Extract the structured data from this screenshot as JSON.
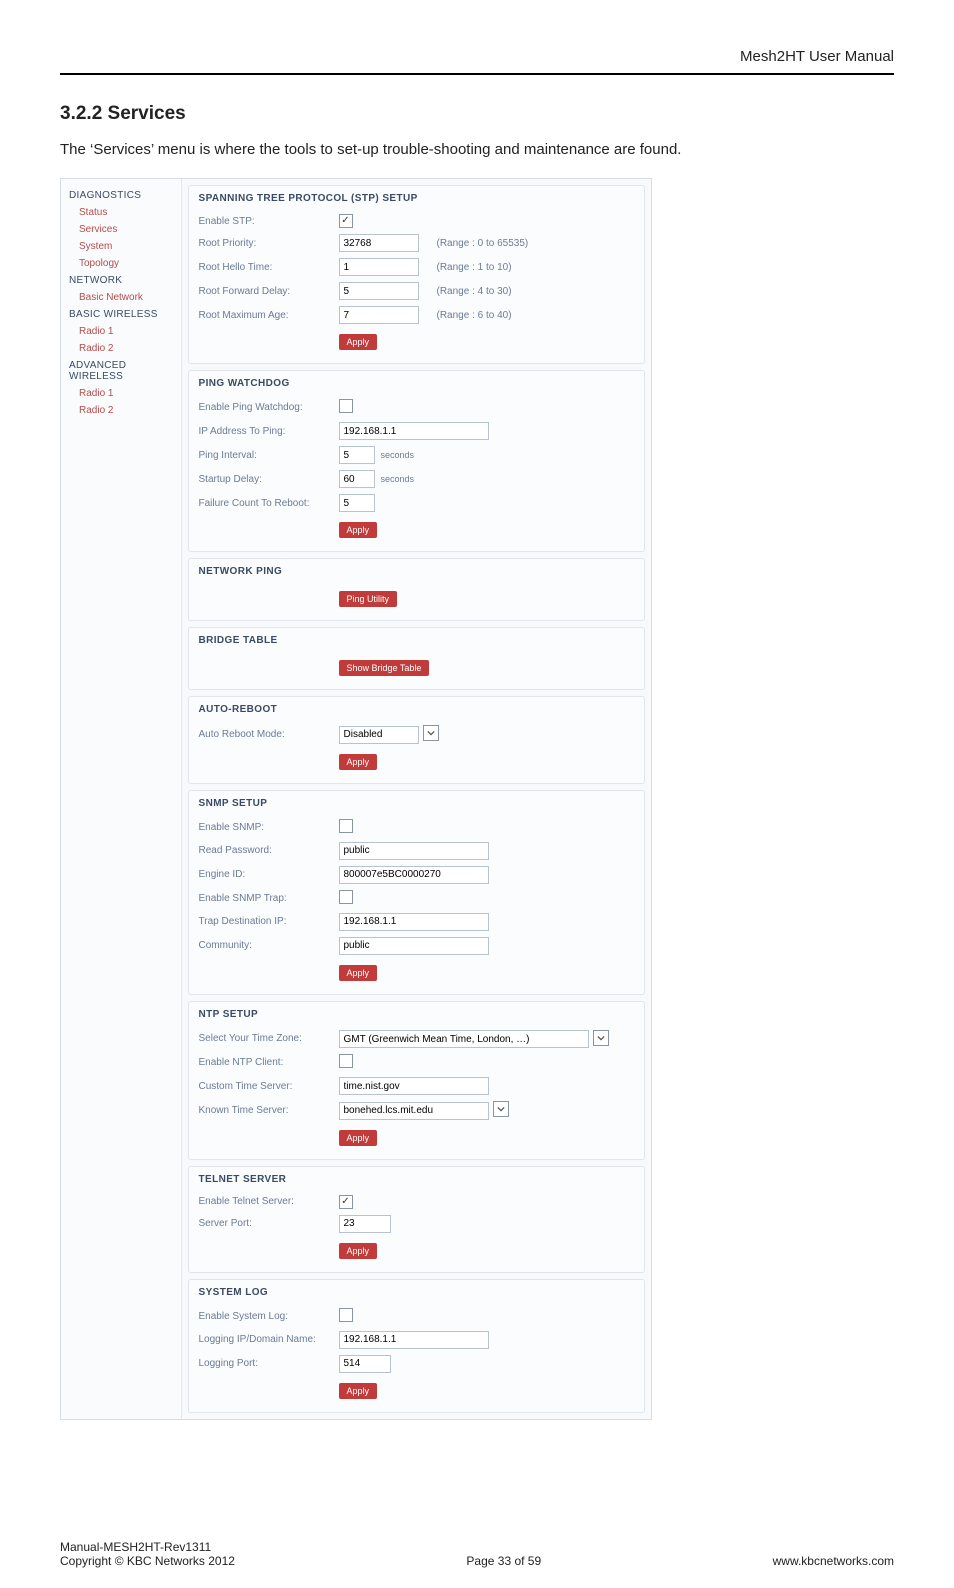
{
  "header": {
    "doc_title": "Mesh2HT User Manual"
  },
  "section": {
    "number_title": "3.2.2 Services",
    "intro": "The ‘Services’ menu is where the tools to set-up trouble-shooting and maintenance are found."
  },
  "nav": {
    "group_diag": "DIAGNOSTICS",
    "diag_items": [
      "Status",
      "Services",
      "System",
      "Topology"
    ],
    "group_net": "NETWORK",
    "net_items": [
      "Basic Network"
    ],
    "group_bw": "BASIC WIRELESS",
    "bw_items": [
      "Radio 1",
      "Radio 2"
    ],
    "group_aw": "ADVANCED WIRELESS",
    "aw_items": [
      "Radio 1",
      "Radio 2"
    ]
  },
  "stp": {
    "title": "SPANNING TREE PROTOCOL (STP) SETUP",
    "enable_label": "Enable STP:",
    "enable_checked": true,
    "priority_label": "Root Priority:",
    "priority_value": "32768",
    "priority_hint": "(Range : 0 to 65535)",
    "hello_label": "Root Hello Time:",
    "hello_value": "1",
    "hello_hint": "(Range : 1 to 10)",
    "fwd_label": "Root Forward Delay:",
    "fwd_value": "5",
    "fwd_hint": "(Range : 4 to 30)",
    "age_label": "Root Maximum Age:",
    "age_value": "7",
    "age_hint": "(Range : 6 to 40)",
    "apply": "Apply"
  },
  "pw": {
    "title": "PING WATCHDOG",
    "enable_label": "Enable Ping Watchdog:",
    "enable_checked": false,
    "ip_label": "IP Address To Ping:",
    "ip_value": "192.168.1.1",
    "interval_label": "Ping Interval:",
    "interval_value": "5",
    "interval_unit": "seconds",
    "delay_label": "Startup Delay:",
    "delay_value": "60",
    "delay_unit": "seconds",
    "fail_label": "Failure Count To Reboot:",
    "fail_value": "5",
    "apply": "Apply"
  },
  "np": {
    "title": "NETWORK PING",
    "btn": "Ping Utility"
  },
  "bt": {
    "title": "BRIDGE TABLE",
    "btn": "Show Bridge Table"
  },
  "ar": {
    "title": "AUTO-REBOOT",
    "mode_label": "Auto Reboot Mode:",
    "mode_value": "Disabled",
    "apply": "Apply"
  },
  "snmp": {
    "title": "SNMP SETUP",
    "enable_label": "Enable SNMP:",
    "enable_checked": false,
    "read_label": "Read Password:",
    "read_value": "public",
    "engine_label": "Engine ID:",
    "engine_value": "800007e5BC0000270",
    "trap_en_label": "Enable SNMP Trap:",
    "trap_en_checked": false,
    "trap_dest_label": "Trap Destination IP:",
    "trap_dest_value": "192.168.1.1",
    "community_label": "Community:",
    "community_value": "public",
    "apply": "Apply"
  },
  "ntp": {
    "title": "NTP SETUP",
    "tz_label": "Select Your Time Zone:",
    "tz_value": "GMT (Greenwich Mean Time, London, …)",
    "client_label": "Enable NTP Client:",
    "client_checked": false,
    "custom_label": "Custom Time Server:",
    "custom_value": "time.nist.gov",
    "known_label": "Known Time Server:",
    "known_value": "bonehed.lcs.mit.edu",
    "apply": "Apply"
  },
  "telnet": {
    "title": "TELNET SERVER",
    "enable_label": "Enable Telnet Server:",
    "enable_checked": true,
    "port_label": "Server Port:",
    "port_value": "23",
    "apply": "Apply"
  },
  "syslog": {
    "title": "SYSTEM LOG",
    "enable_label": "Enable System Log:",
    "enable_checked": false,
    "host_label": "Logging IP/Domain Name:",
    "host_value": "192.168.1.1",
    "port_label": "Logging Port:",
    "port_value": "514",
    "apply": "Apply"
  },
  "footer": {
    "line1": "Manual-MESH2HT-Rev1311",
    "line2": "Copyright © KBC Networks 2012",
    "page": "Page 33 of 59",
    "url": "www.kbcnetworks.com"
  }
}
